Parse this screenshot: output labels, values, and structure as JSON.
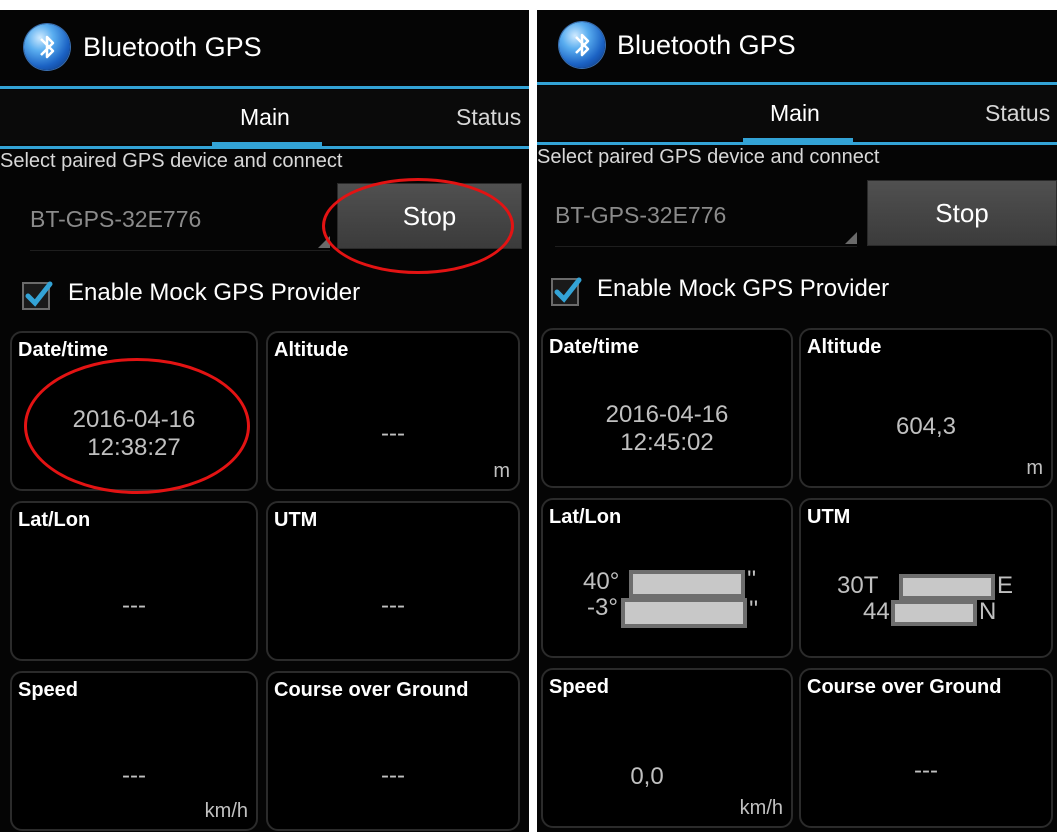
{
  "app": {
    "title": "Bluetooth GPS",
    "icon": "bluetooth-icon"
  },
  "tabs": [
    "Main",
    "Status"
  ],
  "subtitle": "Select paired GPS device and connect",
  "device": {
    "selected": "BT-GPS-32E776"
  },
  "button": {
    "label": "Stop"
  },
  "mock": {
    "label": "Enable Mock GPS Provider",
    "checked": true
  },
  "colors": {
    "accent": "#33a3d6",
    "background": "#050505",
    "highlight_circle": "#e31313"
  },
  "tiles": {
    "datetime": "Date/time",
    "altitude": "Altitude",
    "latlon": "Lat/Lon",
    "utm": "UTM",
    "speed": "Speed",
    "course": "Course over Ground"
  },
  "units": {
    "altitude": "m",
    "speed": "km/h"
  },
  "left_screen": {
    "date": "2016-04-16",
    "time": "12:38:27",
    "altitude": "---",
    "latlon": "---",
    "utm": "---",
    "speed": "---",
    "course": "---"
  },
  "right_screen": {
    "date": "2016-04-16",
    "time": "12:45:02",
    "altitude": "604,3",
    "lat_prefix": "40°",
    "lat_suffix": "''",
    "lon_prefix": "-3°",
    "lon_suffix": "''",
    "utm_zone": "30T",
    "utm_east_suffix": "E",
    "utm_north_prefix": "44",
    "utm_north_suffix": "N",
    "speed": "0,0",
    "course": "---"
  }
}
